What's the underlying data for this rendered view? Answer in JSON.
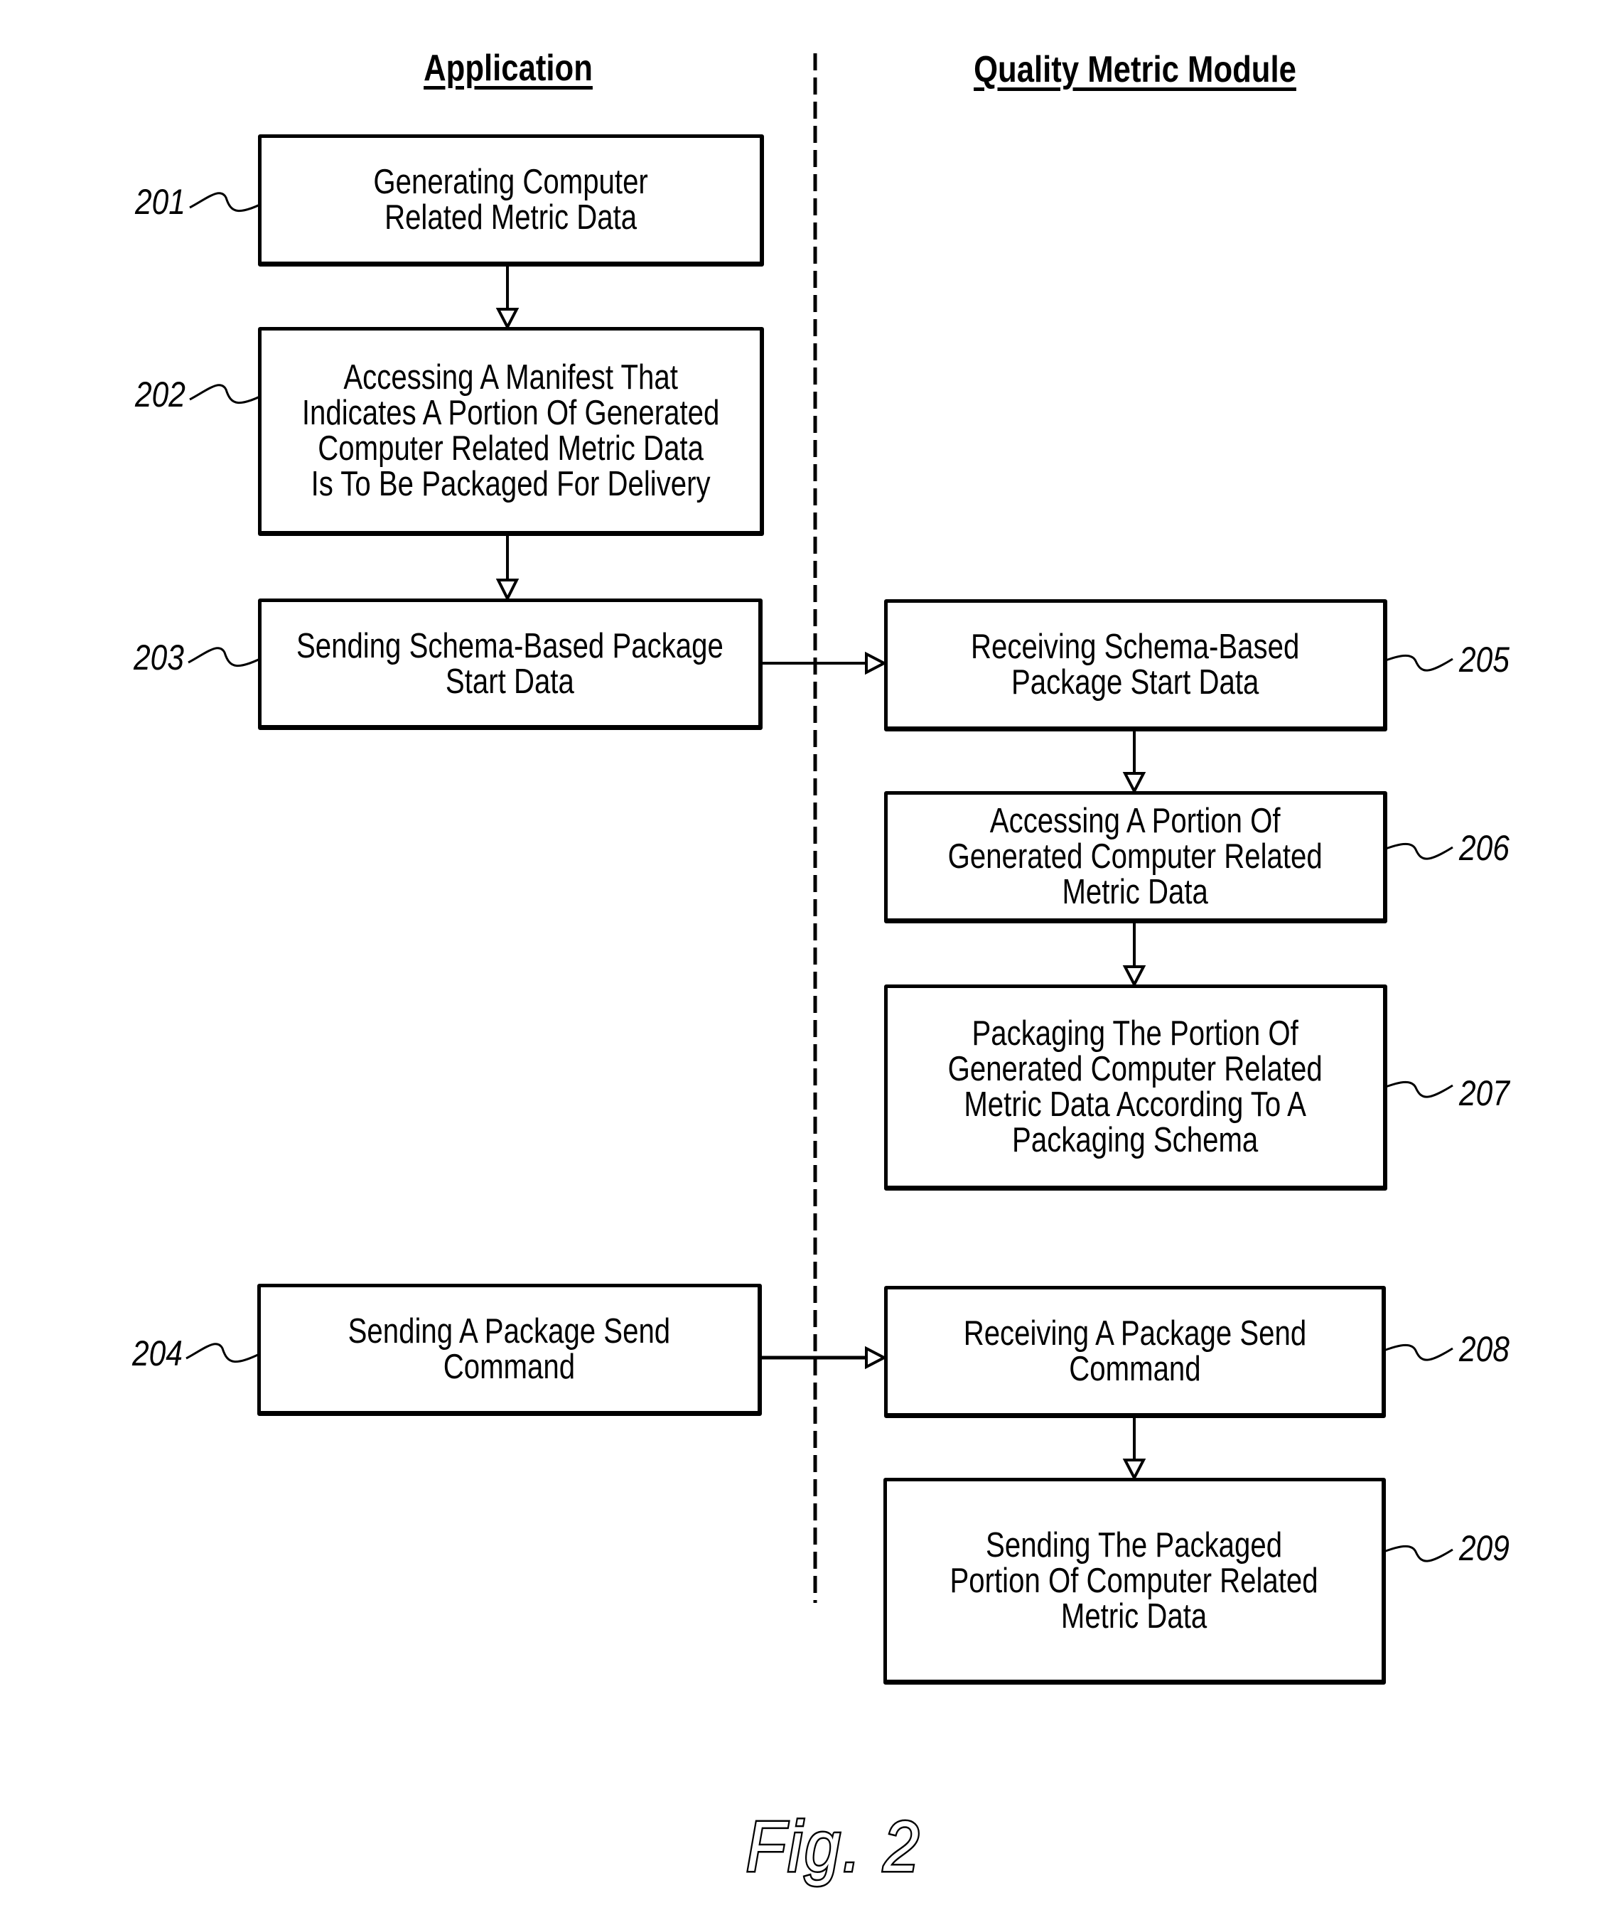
{
  "figure": {
    "caption": "Fig. 2",
    "columns": [
      {
        "id": "application",
        "title": "Application"
      },
      {
        "id": "quality-metric-module",
        "title": "Quality Metric Module"
      }
    ],
    "steps": [
      {
        "ref": "201",
        "column": "application",
        "text": "Generating Computer\nRelated Metric Data"
      },
      {
        "ref": "202",
        "column": "application",
        "text": "Accessing A Manifest That\nIndicates A Portion Of Generated\nComputer Related Metric Data\nIs To Be Packaged For Delivery"
      },
      {
        "ref": "203",
        "column": "application",
        "text": "Sending Schema-Based Package\nStart Data"
      },
      {
        "ref": "204",
        "column": "application",
        "text": "Sending A Package Send\nCommand"
      },
      {
        "ref": "205",
        "column": "quality-metric-module",
        "text": "Receiving Schema-Based\nPackage Start Data"
      },
      {
        "ref": "206",
        "column": "quality-metric-module",
        "text": "Accessing A Portion Of\nGenerated Computer Related\nMetric Data"
      },
      {
        "ref": "207",
        "column": "quality-metric-module",
        "text": "Packaging The Portion Of\nGenerated Computer Related\nMetric Data According To A\nPackaging Schema"
      },
      {
        "ref": "208",
        "column": "quality-metric-module",
        "text": "Receiving A Package Send\nCommand"
      },
      {
        "ref": "209",
        "column": "quality-metric-module",
        "text": "Sending The Packaged\nPortion Of Computer Related\nMetric Data"
      }
    ],
    "connections": [
      {
        "from": "201",
        "to": "202"
      },
      {
        "from": "202",
        "to": "203"
      },
      {
        "from": "203",
        "to": "205"
      },
      {
        "from": "205",
        "to": "206"
      },
      {
        "from": "206",
        "to": "207"
      },
      {
        "from": "204",
        "to": "208"
      },
      {
        "from": "208",
        "to": "209"
      }
    ],
    "colors": {
      "ink": "#000000",
      "background": "#ffffff"
    }
  }
}
